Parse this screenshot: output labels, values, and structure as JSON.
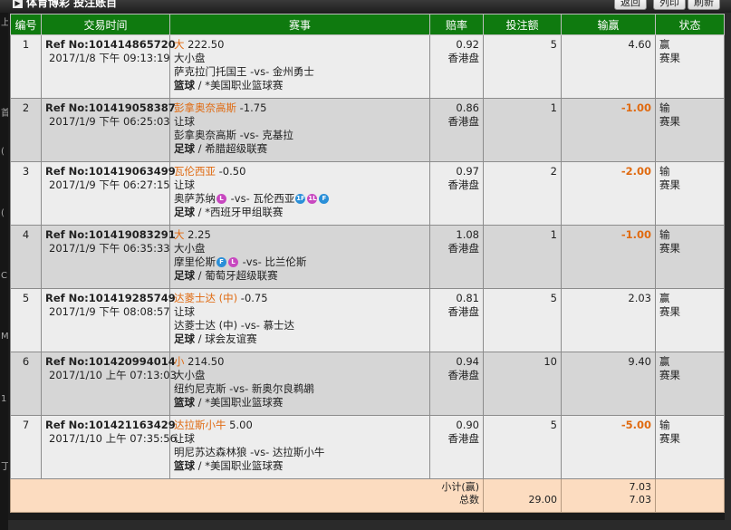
{
  "header": {
    "title": "体育博彩 投注账目",
    "buttons": {
      "back": "返回",
      "print": "列印",
      "refresh": "刷新"
    }
  },
  "left_edge_glyphs": [
    "上",
    "首",
    "(",
    "(",
    "C",
    "M",
    "1",
    "丁"
  ],
  "columns": {
    "no": "编号",
    "time": "交易时间",
    "event": "赛事",
    "odds": "赔率",
    "stake": "投注额",
    "winloss": "输赢",
    "status": "状态"
  },
  "bets": [
    {
      "no": "1",
      "ref": "Ref No:101414865720",
      "time": "2017/1/8 下午 09:13:19",
      "pick": "大",
      "line": "222.50",
      "bet_type": "大小盘",
      "home": "萨克拉门托国王",
      "vs": "-vs-",
      "away": "金州勇士",
      "home_badges": [],
      "away_badges": [],
      "sport": "篮球",
      "league": "*美国职业篮球赛",
      "odds": "0.92",
      "odds_type": "香港盘",
      "stake": "5",
      "winloss": "4.60",
      "result": "赢",
      "status": "赛果"
    },
    {
      "no": "2",
      "ref": "Ref No:101419058387",
      "time": "2017/1/9 下午 06:25:03",
      "pick": "彭拿奥奈高斯",
      "line": "-1.75",
      "bet_type": "让球",
      "home": "彭拿奥奈高斯",
      "vs": "-vs-",
      "away": "克基拉",
      "home_badges": [],
      "away_badges": [],
      "sport": "足球",
      "league": "希腊超级联赛",
      "odds": "0.86",
      "odds_type": "香港盘",
      "stake": "1",
      "winloss": "-1.00",
      "result": "输",
      "status": "赛果"
    },
    {
      "no": "3",
      "ref": "Ref No:101419063499",
      "time": "2017/1/9 下午 06:27:15",
      "pick": "瓦伦西亚",
      "line": "-0.50",
      "bet_type": "让球",
      "home": "奥萨苏纳",
      "vs": "-vs-",
      "away": "瓦伦西亚",
      "home_badges": [
        "L"
      ],
      "away_badges": [
        "1F",
        "1L",
        "F"
      ],
      "sport": "足球",
      "league": "*西班牙甲组联赛",
      "odds": "0.97",
      "odds_type": "香港盘",
      "stake": "2",
      "winloss": "-2.00",
      "result": "输",
      "status": "赛果"
    },
    {
      "no": "4",
      "ref": "Ref No:101419083291",
      "time": "2017/1/9 下午 06:35:33",
      "pick": "大",
      "line": "2.25",
      "bet_type": "大小盘",
      "home": "摩里伦斯",
      "vs": "-vs-",
      "away": "比兰伦斯",
      "home_badges": [
        "F",
        "L"
      ],
      "away_badges": [],
      "sport": "足球",
      "league": "葡萄牙超级联赛",
      "odds": "1.08",
      "odds_type": "香港盘",
      "stake": "1",
      "winloss": "-1.00",
      "result": "输",
      "status": "赛果"
    },
    {
      "no": "5",
      "ref": "Ref No:101419285749",
      "time": "2017/1/9 下午 08:08:57",
      "pick": "达菱士达 (中)",
      "line": "-0.75",
      "bet_type": "让球",
      "home": "达菱士达 (中)",
      "vs": "-vs-",
      "away": "慕士达",
      "home_badges": [],
      "away_badges": [],
      "sport": "足球",
      "league": "球会友谊赛",
      "odds": "0.81",
      "odds_type": "香港盘",
      "stake": "5",
      "winloss": "2.03",
      "result": "赢",
      "status": "赛果"
    },
    {
      "no": "6",
      "ref": "Ref No:101420994014",
      "time": "2017/1/10 上午 07:13:03",
      "pick": "小",
      "line": "214.50",
      "bet_type": "大小盘",
      "home": "纽约尼克斯",
      "vs": "-vs-",
      "away": "新奥尔良鹈鹕",
      "home_badges": [],
      "away_badges": [],
      "sport": "篮球",
      "league": "*美国职业篮球赛",
      "odds": "0.94",
      "odds_type": "香港盘",
      "stake": "10",
      "winloss": "9.40",
      "result": "赢",
      "status": "赛果"
    },
    {
      "no": "7",
      "ref": "Ref No:101421163429",
      "time": "2017/1/10 上午 07:35:56",
      "pick": "达拉斯小牛",
      "line": "5.00",
      "bet_type": "让球",
      "home": "明尼苏达森林狼",
      "vs": "-vs-",
      "away": "达拉斯小牛",
      "home_badges": [],
      "away_badges": [],
      "sport": "篮球",
      "league": "*美国职业篮球赛",
      "odds": "0.90",
      "odds_type": "香港盘",
      "stake": "5",
      "winloss": "-5.00",
      "result": "输",
      "status": "赛果"
    }
  ],
  "summary": {
    "subtotal_label": "小计(赢)",
    "total_label": "总数",
    "subtotal_winloss": "7.03",
    "total_stake": "29.00",
    "total_winloss": "7.03"
  },
  "colors": {
    "header_green": "#0f7a0f",
    "highlight_orange": "#e06a10",
    "summary_bg": "#fcdcc0"
  }
}
